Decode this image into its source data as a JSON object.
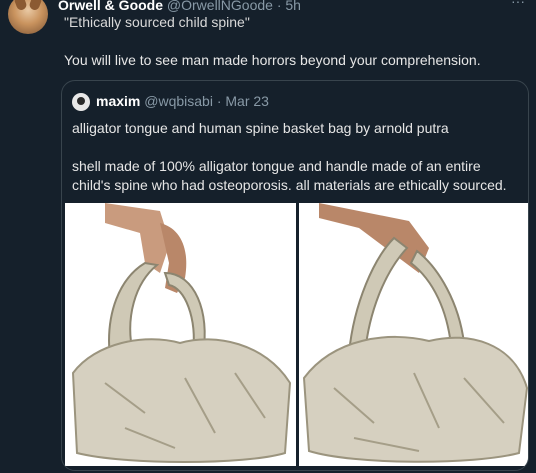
{
  "tweet": {
    "author_name": "Orwell & Goode",
    "author_handle": "@OrwellNGoode · 5h",
    "quoted_line": "\"Ethically sourced child spine\"",
    "body": "You will live to see man made horrors beyond your comprehension."
  },
  "quote": {
    "author_name": "maxim",
    "author_handle": "@wqbisabi · Mar 23",
    "line1": "alligator tongue and human spine basket bag by arnold putra",
    "line2": "shell made of 100% alligator tongue and handle made of an entire child's spine who had osteoporosis. all materials are ethically sourced."
  },
  "icons": {
    "more": "more-icon",
    "avatar": "dog-avatar",
    "quote_avatar": "cat-avatar"
  },
  "colors": {
    "background": "#15202b",
    "secondary_text": "#8899a6",
    "border": "#38444d"
  }
}
